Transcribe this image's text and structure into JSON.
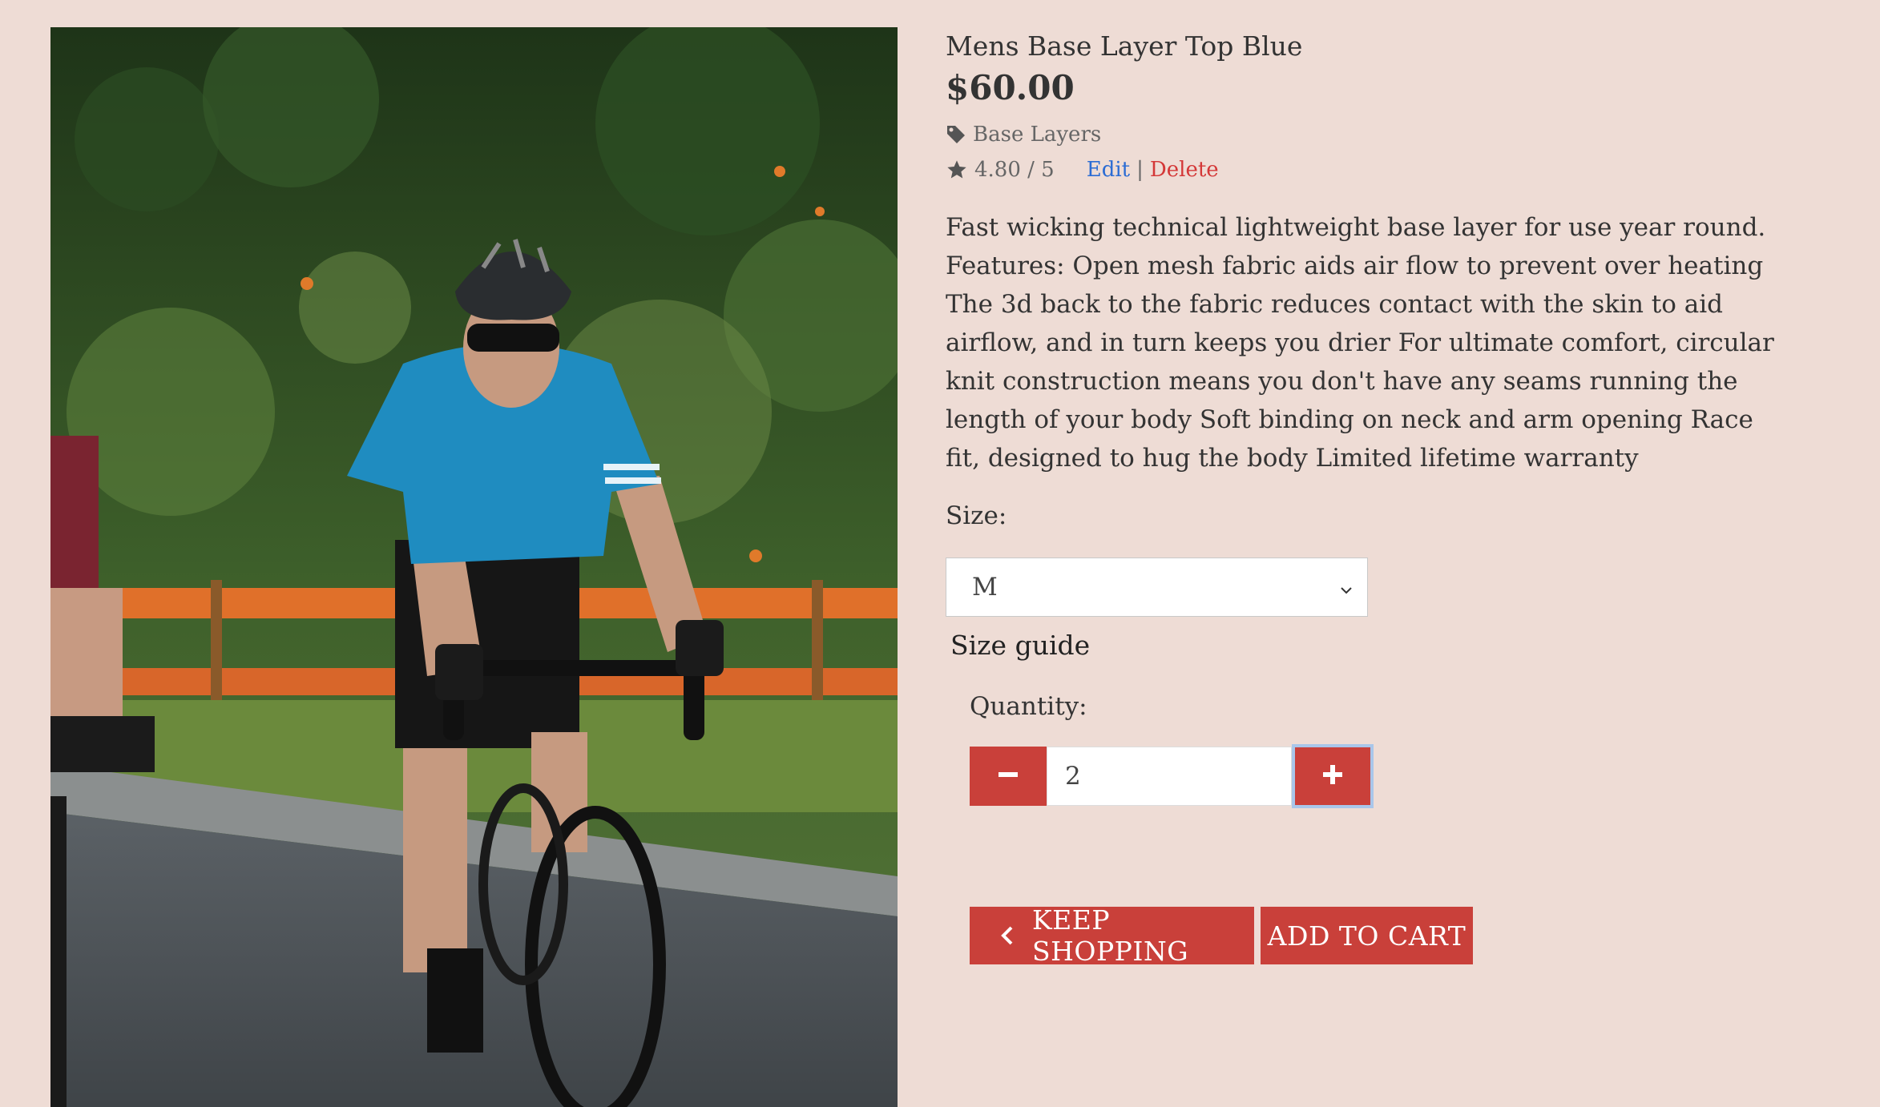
{
  "product": {
    "name": "Mens Base Layer Top Blue",
    "price": "$60.00",
    "category": "Base Layers",
    "category_icon": "tag-icon",
    "rating": "4.80 / 5",
    "rating_icon": "star-icon",
    "edit_label": "Edit",
    "separator": "|",
    "delete_label": "Delete",
    "description": "Fast wicking technical lightweight base layer for use year round. Features: Open mesh fabric aids air flow to prevent over heating The 3d back to the fabric reduces contact with the skin to aid airflow, and in turn keeps you drier For ultimate comfort, circular knit construction means you don't have any seams running the length of your body Soft binding on neck and arm opening Race fit, designed to hug the body Limited lifetime warranty"
  },
  "size": {
    "label": "Size:",
    "selected": "M",
    "guide_label": "Size guide"
  },
  "quantity": {
    "label": "Quantity:",
    "value": "2"
  },
  "actions": {
    "keep_shopping": "KEEP SHOPPING",
    "add_to_cart": "ADD TO CART"
  },
  "colors": {
    "background": "#eedcd5",
    "accent": "#c9403a",
    "edit_link": "#2b6cd4",
    "delete_link": "#d43838"
  }
}
